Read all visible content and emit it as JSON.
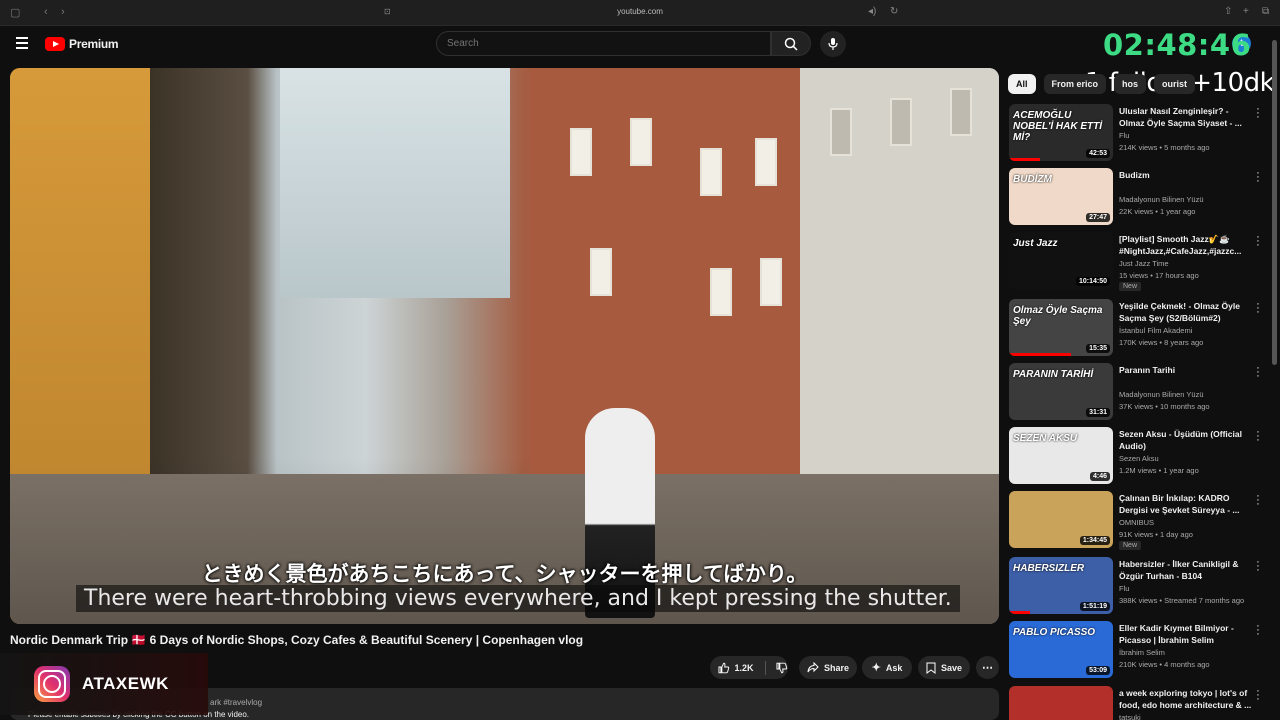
{
  "browser": {
    "url": "youtube.com"
  },
  "header": {
    "logo_text": "Premium",
    "search_placeholder": "Search",
    "avatar_letter": "t"
  },
  "overlay": {
    "clock": "02:48:46",
    "follow_text": "1 follow +10dk"
  },
  "video": {
    "subtitle_jp": "ときめく景色があちこちにあって、シャッターを押してばかり。",
    "subtitle_en": "There were heart-throbbing views everywhere, and I kept pressing the shutter.",
    "title": "Nordic Denmark Trip 🇩🇰 6 Days of Nordic Shops, Cozy Cafes & Beautiful Scenery | Copenhagen vlog"
  },
  "actions": {
    "likes": "1.2K",
    "share": "Share",
    "ask": "Ask",
    "save": "Save"
  },
  "description": {
    "tags": "ark #travelvlog",
    "note": "Please enable subtitles by clicking the CC button on the video."
  },
  "instagram": {
    "handle": "ATAXEWK"
  },
  "chips": [
    "All",
    "From erico",
    "hos",
    "ourist"
  ],
  "recommendations": [
    {
      "title": "Uluslar Nasıl Zenginleşir? - Olmaz Öyle Saçma Siyaset - ...",
      "channel": "Flu",
      "meta": "214K views • 5 months ago",
      "duration": "42:53",
      "thumb_text": "ACEMOĞLU NOBEL'İ HAK ETTİ Mİ?",
      "thumb_color": "#2a2a2a",
      "progress": 0.3,
      "is_new": false
    },
    {
      "title": "Budizm",
      "channel": "Madalyonun Bilinen Yüzü",
      "meta": "22K views • 1 year ago",
      "duration": "27:47",
      "thumb_text": "BUDİZM",
      "thumb_color": "#f0d9c8",
      "progress": 0,
      "is_new": false
    },
    {
      "title": "[Playlist] Smooth Jazz🎷☕ #NightJazz,#CafeJazz,#jazzc...",
      "channel": "Just Jazz Time",
      "meta": "15 views • 17 hours ago",
      "duration": "10:14:50",
      "thumb_text": "Just Jazz",
      "thumb_color": "#111111",
      "progress": 0,
      "is_new": true
    },
    {
      "title": "Yeşilde Çekmek! - Olmaz Öyle Saçma Şey (S2/Bölüm#2)",
      "channel": "İstanbul Film Akademi",
      "meta": "170K views • 8 years ago",
      "duration": "15:35",
      "thumb_text": "Olmaz Öyle Saçma Şey",
      "thumb_color": "#444444",
      "progress": 0.6,
      "is_new": false
    },
    {
      "title": "Paranın Tarihi",
      "channel": "Madalyonun Bilinen Yüzü",
      "meta": "37K views • 10 months ago",
      "duration": "31:31",
      "thumb_text": "PARANIN TARİHİ",
      "thumb_color": "#3a3a3a",
      "progress": 0,
      "is_new": false
    },
    {
      "title": "Sezen Aksu - Üşüdüm (Official Audio)",
      "channel": "Sezen Aksu",
      "meta": "1.2M views • 1 year ago",
      "duration": "4:46",
      "thumb_text": "SEZEN AKSU",
      "thumb_color": "#e8e8e8",
      "progress": 0,
      "is_new": false
    },
    {
      "title": "Çalınan Bir İnkılap: KADRO Dergisi ve Şevket Süreyya - ...",
      "channel": "OMNIBUS",
      "meta": "91K views • 1 day ago",
      "duration": "1:34:45",
      "thumb_text": "",
      "thumb_color": "#c9a35a",
      "progress": 0,
      "is_new": true
    },
    {
      "title": "Habersizler - İlker Canikligil & Özgür Turhan - B104",
      "channel": "Flu",
      "meta": "388K views • Streamed 7 months ago",
      "duration": "1:51:19",
      "thumb_text": "HABERSIZLER",
      "thumb_color": "#3d5fa8",
      "progress": 0.2,
      "is_new": false
    },
    {
      "title": "Eller Kadir Kıymet Bilmiyor - Picasso | İbrahim Selim",
      "channel": "İbrahim Selim",
      "meta": "210K views • 4 months ago",
      "duration": "53:09",
      "thumb_text": "PABLO PICASSO",
      "thumb_color": "#2a6ad6",
      "progress": 0,
      "is_new": false
    },
    {
      "title": "a week exploring tokyo | lot's of food, edo home architecture & ...",
      "channel": "tatsuki",
      "meta": "",
      "duration": "",
      "thumb_text": "",
      "thumb_color": "#b3302a",
      "progress": 0,
      "is_new": false
    }
  ]
}
